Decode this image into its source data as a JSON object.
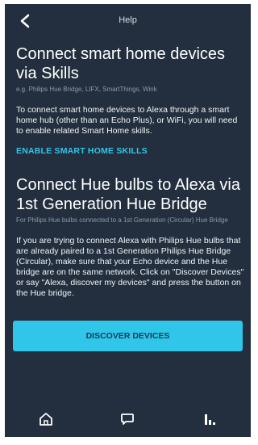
{
  "header": {
    "title": "Help",
    "back_icon": "chevron-left-icon"
  },
  "sections": [
    {
      "title": "Connect smart home devices via Skills",
      "subtitle": "e.g. Philips Hue Bridge, LIFX, SmartThings, Wink",
      "body": "To connect smart home devices to Alexa through a smart home hub (other than an Echo Plus), or WiFi, you will need to enable related Smart Home skills.",
      "link": "ENABLE SMART HOME SKILLS"
    },
    {
      "title": "Connect Hue bulbs to Alexa via 1st Generation Hue Bridge",
      "subtitle": "For Philips Hue bulbs connected to a 1st Generation (Circular) Hue Bridge",
      "body": "If you are trying to connect Alexa with Philips Hue bulbs that are already paired to a 1st Generation Philips Hue Bridge (Circular), make sure that your Echo device and the Hue bridge are on the same network. Click on \"Discover Devices\" or say \"Alexa, discover my devices\" and press the button on the Hue bridge."
    }
  ],
  "primary_button": {
    "label": "DISCOVER DEVICES"
  },
  "nav": {
    "items": [
      "home-icon",
      "chat-bubble-icon",
      "bar-chart-icon"
    ]
  },
  "colors": {
    "background": "#232f3e",
    "accent": "#2fc6ea",
    "text": "#ffffff",
    "subtext": "#8f9aa8"
  }
}
